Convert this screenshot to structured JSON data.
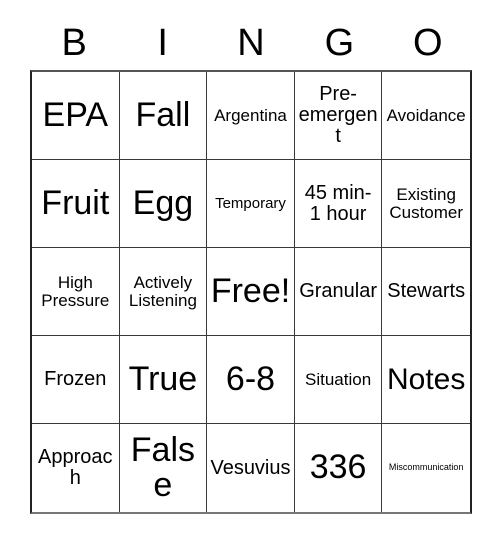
{
  "card": {
    "title": "BINGO Card",
    "header_letters": [
      "B",
      "I",
      "N",
      "G",
      "O"
    ],
    "free_space_label": "Free!",
    "colors": {
      "text": "#000000",
      "grid_line": "#3a3a3a",
      "background": "#ffffff"
    },
    "grid": {
      "rows": 5,
      "columns": 5,
      "cells": [
        [
          {
            "label": "EPA",
            "size": "xl"
          },
          {
            "label": "Fall",
            "size": "xl"
          },
          {
            "label": "Argentina",
            "size": "sm"
          },
          {
            "label": "Pre-emergent",
            "size": "md"
          },
          {
            "label": "Avoidance",
            "size": "sm"
          }
        ],
        [
          {
            "label": "Fruit",
            "size": "xl"
          },
          {
            "label": "Egg",
            "size": "xl"
          },
          {
            "label": "Temporary",
            "size": "xs"
          },
          {
            "label": "45 min- 1 hour",
            "size": "md"
          },
          {
            "label": "Existing Customer",
            "size": "sm"
          }
        ],
        [
          {
            "label": "High Pressure",
            "size": "sm"
          },
          {
            "label": "Actively Listening",
            "size": "sm"
          },
          {
            "label": "Free!",
            "size": "xl"
          },
          {
            "label": "Granular",
            "size": "md"
          },
          {
            "label": "Stewarts",
            "size": "md"
          }
        ],
        [
          {
            "label": "Frozen",
            "size": "md"
          },
          {
            "label": "True",
            "size": "xl"
          },
          {
            "label": "6-8",
            "size": "xl"
          },
          {
            "label": "Situation",
            "size": "sm"
          },
          {
            "label": "Notes",
            "size": "lg"
          }
        ],
        [
          {
            "label": "Approach",
            "size": "md"
          },
          {
            "label": "False",
            "size": "xl"
          },
          {
            "label": "Vesuvius",
            "size": "md"
          },
          {
            "label": "336",
            "size": "xl"
          },
          {
            "label": "Miscommunication",
            "size": "tiny"
          }
        ]
      ]
    }
  }
}
